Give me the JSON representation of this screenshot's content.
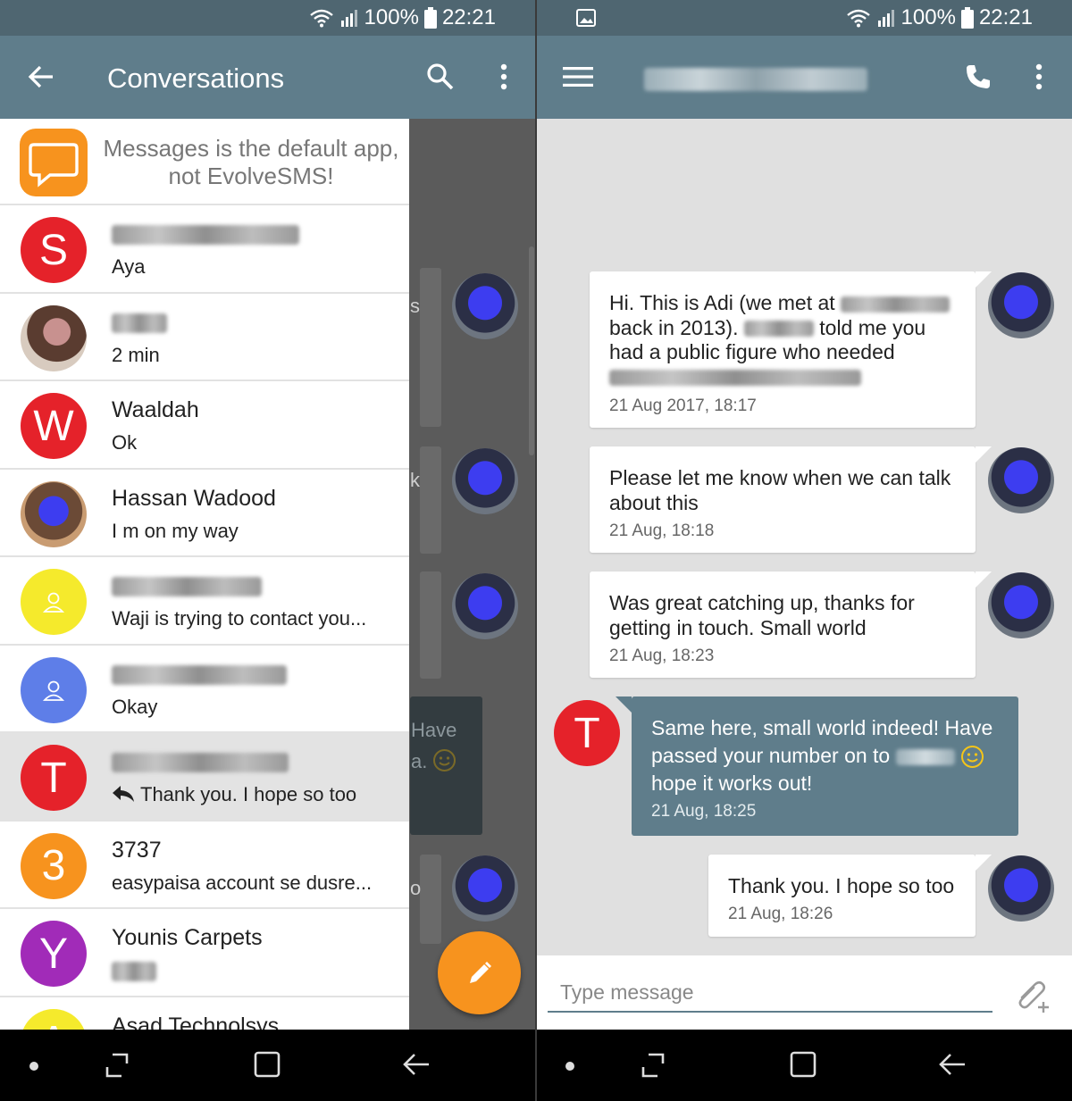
{
  "status": {
    "battery": "100%",
    "time": "22:21"
  },
  "left": {
    "title": "Conversations",
    "banner": "Messages is the default app, not EvolveSMS!",
    "conversations": [
      {
        "initial": "S",
        "color": "#e5222a",
        "preview": "Aya"
      },
      {
        "initial": "",
        "color": "",
        "preview": "2 min"
      },
      {
        "initial": "W",
        "color": "#e5222a",
        "name": "Waaldah",
        "preview": "Ok"
      },
      {
        "initial": "",
        "color": "",
        "name": "Hassan Wadood",
        "preview": "I m on my way"
      },
      {
        "initial": "",
        "color": "#f5ea2c",
        "preview": "Waji is trying to contact you..."
      },
      {
        "initial": "",
        "color": "#5e7ee8",
        "preview": "Okay"
      },
      {
        "initial": "T",
        "color": "#e5222a",
        "preview": "Thank you. I hope so too"
      },
      {
        "initial": "3",
        "color": "#f7931e",
        "name": "3737",
        "preview": "easypaisa account se dusre..."
      },
      {
        "initial": "Y",
        "color": "#a12bb8",
        "name": "Younis Carpets",
        "preview": ""
      },
      {
        "initial": "A",
        "color": "#f5ea2c",
        "name": "Asad Technolsys",
        "preview": ""
      }
    ],
    "bg_peek": [
      "s",
      "k",
      "Have",
      "a.",
      "o"
    ]
  },
  "right": {
    "messages": [
      {
        "lines": [
          "Hi. This is Adi (we met at",
          "back in 2013).",
          "told me you",
          "had a public figure who needed"
        ],
        "time": "21 Aug 2017, 18:17"
      },
      {
        "text": "Please let me know when we can talk about this",
        "time": "21 Aug, 18:18"
      },
      {
        "text": "Was great catching up, thanks for getting in touch. Small world",
        "time": "21 Aug, 18:23"
      },
      {
        "lines": [
          "Same here, small world indeed! Have",
          "passed your number on to",
          "hope it works out!"
        ],
        "time": "21 Aug, 18:25",
        "initial": "T"
      },
      {
        "text": "Thank you. I hope so too",
        "time": "21 Aug, 18:26"
      }
    ],
    "compose_placeholder": "Type message"
  },
  "colors": {
    "toolbar": "#5f7d8b",
    "statusbar": "#4f6671",
    "accent": "#f7931e",
    "red": "#e5222a"
  }
}
